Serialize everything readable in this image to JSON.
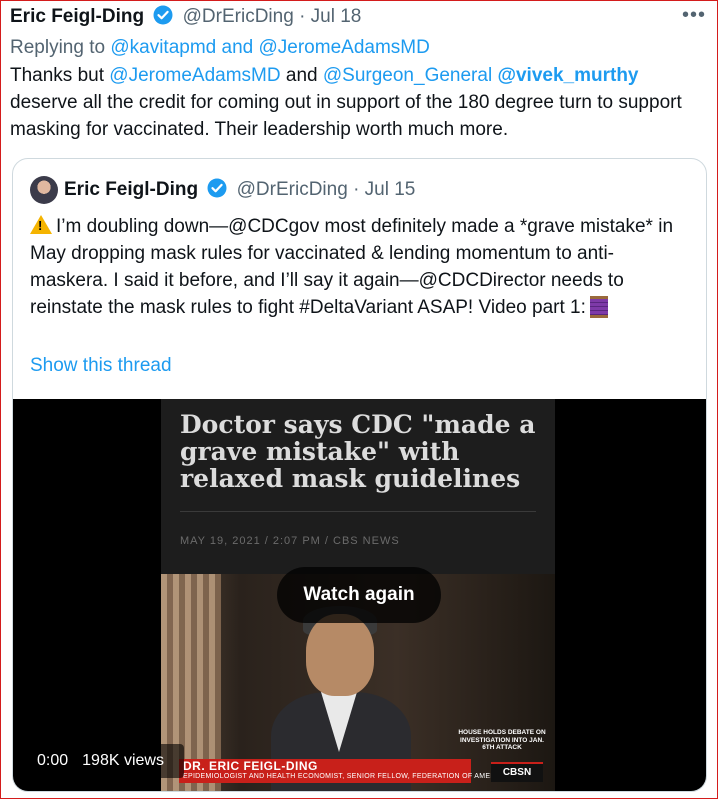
{
  "tweet": {
    "author_name": "Eric Feigl-Ding",
    "handle": "@DrEricDing",
    "separator": "·",
    "date": "Jul 18",
    "more_icon": "more-icon",
    "reply_prefix": "Replying to",
    "reply_to_1": "@kavitapmd",
    "reply_and": "and",
    "reply_to_2": "@JeromeAdamsMD",
    "text_1": "Thanks but",
    "mention_1": "@JeromeAdamsMD",
    "text_2": "and",
    "mention_2": "@Surgeon_General",
    "mention_3": "@vivek_murthy",
    "text_3": "deserve all the credit for coming out in support of the 180 degree turn to support masking for vaccinated. Their leadership worth much more."
  },
  "quote": {
    "author_name": "Eric Feigl-Ding",
    "handle": "@DrEricDing",
    "separator": "·",
    "date": "Jul 15",
    "text": "I’m doubling down—@CDCgov most definitely made a *grave mistake* in May dropping mask rules for vaccinated & lending momentum to anti-maskera. I said it before, and I’ll say it again—@CDCDirector needs to reinstate the mask rules to fight #DeltaVariant ASAP! Video part 1:",
    "show_thread": "Show this thread"
  },
  "video": {
    "headline": "Doctor says CDC \"made a grave mistake\" with relaxed mask guidelines",
    "dateline": "MAY 19, 2021 / 2:07 PM / CBS NEWS",
    "lower_third_name": "DR. ERIC FEIGL-DING",
    "lower_third_role": "EPIDEMIOLOGIST AND HEALTH ECONOMIST, SENIOR FELLOW, FEDERATION OF AMERICAN SCI",
    "ticker": "HOUSE HOLDS DEBATE ON INVESTIGATION INTO JAN. 6TH ATTACK",
    "network": "CBSN",
    "watch_again": "Watch again",
    "time": "0:00",
    "views": "198K views"
  },
  "colors": {
    "accent": "#1d9bf0",
    "text": "#0f1419",
    "muted": "#536471"
  }
}
